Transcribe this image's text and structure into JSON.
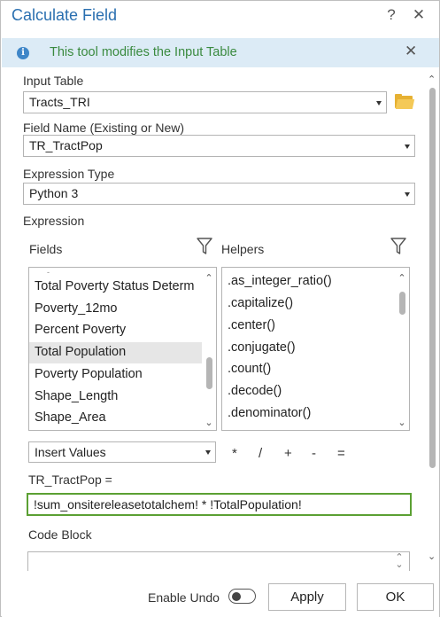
{
  "window": {
    "title": "Calculate Field",
    "help_glyph": "?",
    "close_glyph": "✕"
  },
  "banner": {
    "message": "This tool modifies the Input Table",
    "info_glyph": "i",
    "close_glyph": "✕"
  },
  "input_table": {
    "label": "Input Table",
    "value": "Tracts_TRI"
  },
  "field_name": {
    "label": "Field Name (Existing or New)",
    "value": "TR_TractPop"
  },
  "expression_type": {
    "label": "Expression Type",
    "value": "Python 3"
  },
  "expression": {
    "label": "Expression",
    "fields_label": "Fields",
    "helpers_label": "Helpers",
    "fields": [
      "Total Poverty Status Determ",
      "Poverty_12mo",
      "Percent Poverty",
      "Total Population",
      "Poverty Population",
      "Shape_Length",
      "Shape_Area"
    ],
    "selected_field": "Total Population",
    "helpers": [
      ".as_integer_ratio()",
      ".capitalize()",
      ".center()",
      ".conjugate()",
      ".count()",
      ".decode()",
      ".denominator()"
    ],
    "insert_values": "Insert Values",
    "operators": [
      "*",
      "/",
      "+",
      "-",
      "="
    ],
    "target_label": "TR_TractPop =",
    "text": "!sum_onsitereleasetotalchem! * !TotalPopulation!"
  },
  "code_block": {
    "label": "Code Block"
  },
  "footer": {
    "enable_undo_label": "Enable Undo",
    "enable_undo_on": false,
    "apply_label": "Apply",
    "ok_label": "OK"
  },
  "colors": {
    "title": "#2a6fb0",
    "banner_bg": "#dcebf6",
    "banner_text": "#3a8a3f",
    "focus_border": "#5ba033",
    "selection": "#e6e6e6"
  }
}
